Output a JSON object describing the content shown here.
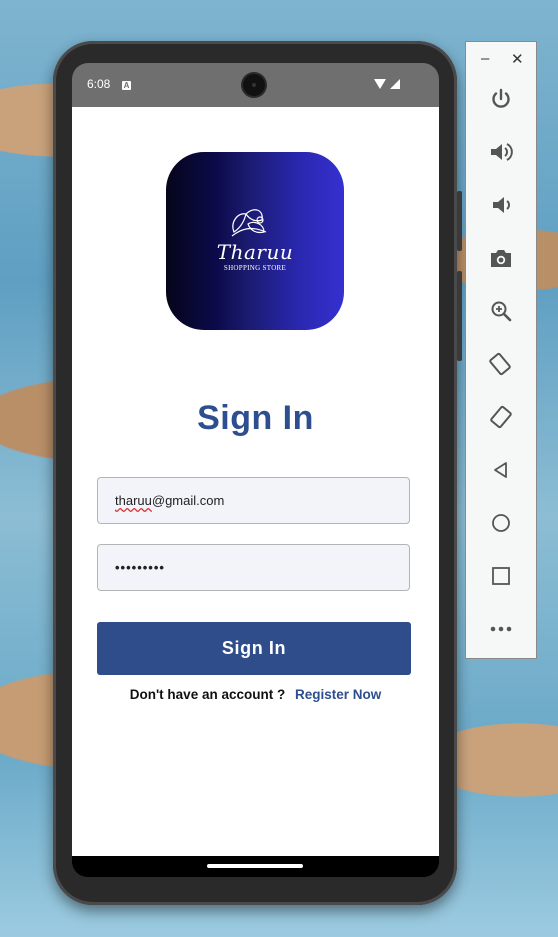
{
  "status_bar": {
    "time": "6:08",
    "notification_badge": "A"
  },
  "app": {
    "logo": {
      "brand_name": "Tharuu",
      "tagline": "SHOPPING STORE"
    },
    "title": "Sign In",
    "email_field": {
      "value_prefix": "tharuu",
      "value_suffix": "@gmail.com"
    },
    "password_field": {
      "value": "•••••••••"
    },
    "signin_button": "Sign In",
    "register_prompt": "Don't have an account ?",
    "register_link": "Register Now"
  },
  "emulator_toolbar": {
    "minimize": "–",
    "close": "✕",
    "buttons": [
      "power-icon",
      "volume-up-icon",
      "volume-down-icon",
      "camera-icon",
      "zoom-icon",
      "rotate-left-icon",
      "rotate-right-icon",
      "back-icon",
      "home-icon",
      "overview-icon",
      "more-icon"
    ]
  },
  "colors": {
    "accent": "#2f4d8b",
    "title": "#2e4f8f",
    "status_bar": "#6f6f6f"
  }
}
